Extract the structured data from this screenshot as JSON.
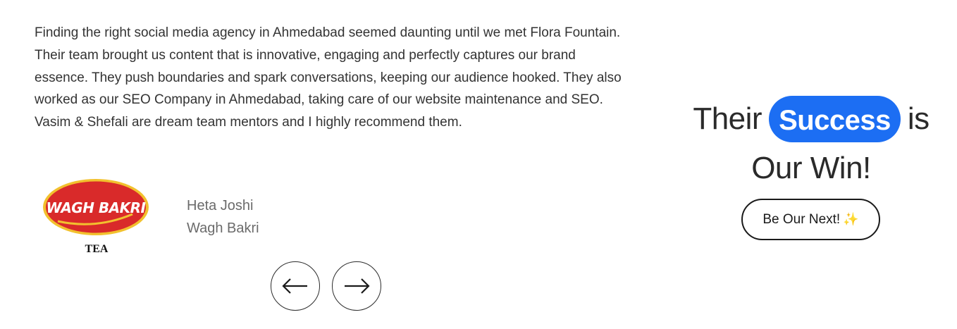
{
  "testimonial": {
    "text": "Finding the right social media agency in Ahmedabad seemed daunting until we met Flora Fountain. Their team brought us content that is innovative, engaging and perfectly captures our brand essence. They push boundaries and spark conversations, keeping our audience hooked. They also worked as our SEO Company in Ahmedabad, taking care of our website maintenance and SEO. Vasim & Shefali are dream team mentors and I highly recommend them.",
    "author_name": "Heta Joshi",
    "author_company": "Wagh Bakri",
    "logo": {
      "brand_text": "WAGH BAKRI",
      "sub_text": "TEA",
      "colors": {
        "oval": "#d92a2a",
        "border": "#f2c12e",
        "text": "#ffffff"
      }
    }
  },
  "carousel": {
    "prev_icon": "arrow-left-icon",
    "next_icon": "arrow-right-icon"
  },
  "headline": {
    "word1": "Their",
    "highlight": "Success",
    "word2": "is",
    "line2": "Our Win!",
    "accent_color": "#1c6ef3"
  },
  "cta": {
    "label": "Be Our Next!",
    "icon": "sparkles-icon"
  }
}
